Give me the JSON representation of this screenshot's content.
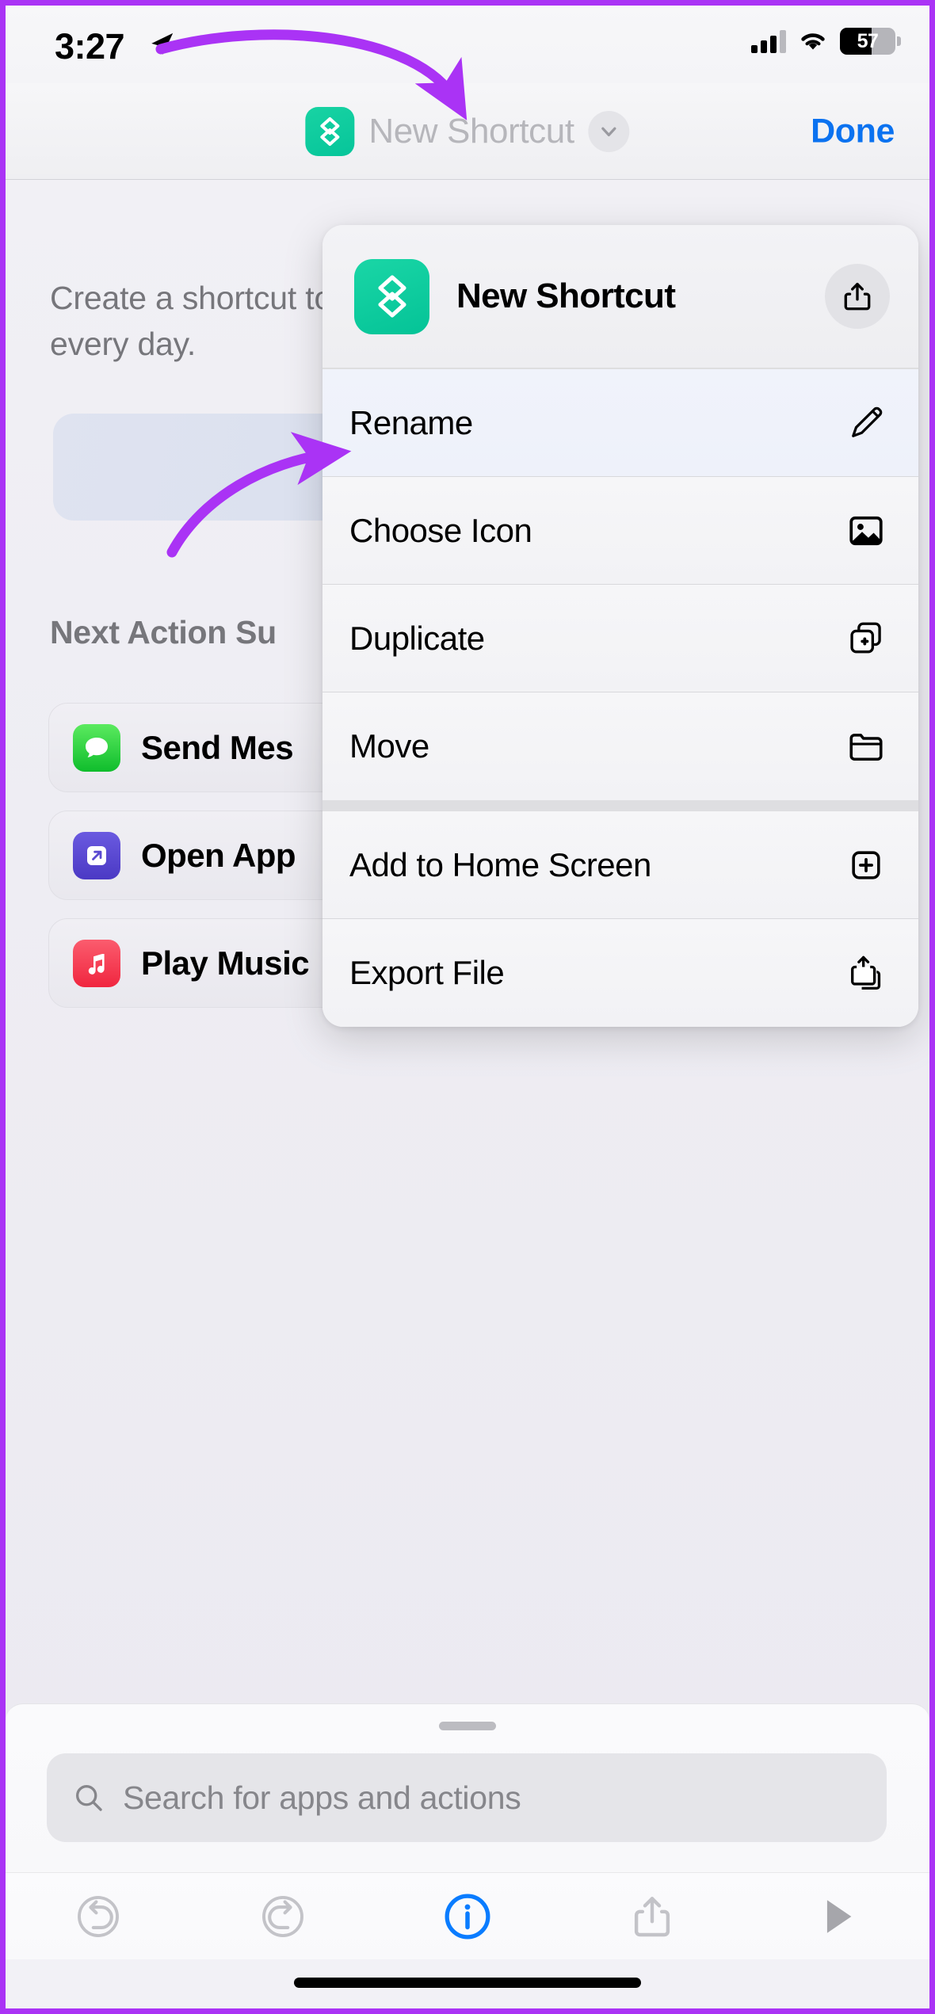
{
  "status_bar": {
    "time": "3:27",
    "location_icon": "location-arrow-icon",
    "cellular_icon": "cellular-signal-icon",
    "wifi_icon": "wifi-icon",
    "battery_percent": "57",
    "battery_level": 57
  },
  "nav_bar": {
    "icon": "shortcut-glyph-icon",
    "title": "New Shortcut",
    "chevron_icon": "chevron-down-icon",
    "done_label": "Done"
  },
  "page": {
    "intro_text": "Create a shortcut to get things done in the apps every day.",
    "next_action_title": "Next Action Su",
    "actions": [
      {
        "label": "Send Mes",
        "icon": "messages-icon",
        "color": "#34c759",
        "plus": ""
      },
      {
        "label": "Open App",
        "icon": "open-app-icon",
        "color": "#5a4ad1",
        "plus": ""
      },
      {
        "label": "Play Music",
        "icon": "music-icon",
        "color": "#f4455a",
        "plus": "+"
      }
    ]
  },
  "context_menu": {
    "header": {
      "icon": "shortcut-glyph-icon",
      "title": "New Shortcut",
      "share_icon": "share-icon"
    },
    "groups": [
      {
        "items": [
          {
            "label": "Rename",
            "icon": "pencil-icon",
            "highlighted": true
          },
          {
            "label": "Choose Icon",
            "icon": "photo-icon",
            "highlighted": false
          },
          {
            "label": "Duplicate",
            "icon": "duplicate-icon",
            "highlighted": false
          },
          {
            "label": "Move",
            "icon": "folder-icon",
            "highlighted": false
          }
        ]
      },
      {
        "items": [
          {
            "label": "Add to Home Screen",
            "icon": "plus-square-icon",
            "highlighted": false
          },
          {
            "label": "Export File",
            "icon": "export-icon",
            "highlighted": false
          }
        ]
      }
    ]
  },
  "search": {
    "grabber": "sheet-grabber",
    "search_icon": "search-icon",
    "placeholder": "Search for apps and actions"
  },
  "toolbar": {
    "buttons": [
      {
        "name": "undo-button",
        "icon": "undo-icon",
        "enabled": false
      },
      {
        "name": "redo-button",
        "icon": "redo-icon",
        "enabled": false
      },
      {
        "name": "info-button",
        "icon": "info-circle-icon",
        "enabled": true
      },
      {
        "name": "share-button",
        "icon": "share-icon",
        "enabled": false
      },
      {
        "name": "play-button",
        "icon": "play-icon",
        "enabled": false
      }
    ]
  },
  "annotations": {
    "accent_color": "#aa33f5",
    "arrows": [
      {
        "name": "arrow-to-title",
        "target": "nav-title"
      },
      {
        "name": "arrow-to-rename",
        "target": "menu-item-rename"
      }
    ]
  }
}
